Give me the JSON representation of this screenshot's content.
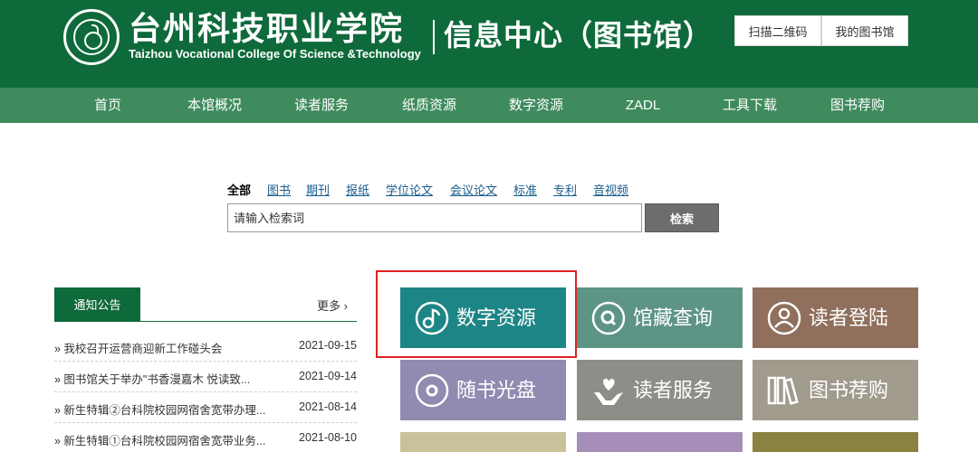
{
  "header": {
    "college_name_cn": "台州科技职业学院",
    "college_name_en": "Taizhou Vocational College Of Science &Technology",
    "center_title": "信息中心（图书馆）",
    "buttons": [
      {
        "label": "扫描二维码"
      },
      {
        "label": "我的图书馆"
      }
    ]
  },
  "nav": {
    "items": [
      {
        "label": "首页"
      },
      {
        "label": "本馆概况"
      },
      {
        "label": "读者服务"
      },
      {
        "label": "纸质资源"
      },
      {
        "label": "数字资源"
      },
      {
        "label": "ZADL"
      },
      {
        "label": "工具下载"
      },
      {
        "label": "图书荐购"
      }
    ]
  },
  "search": {
    "tabs": [
      {
        "label": "全部",
        "active": true
      },
      {
        "label": "图书"
      },
      {
        "label": "期刊"
      },
      {
        "label": "报纸"
      },
      {
        "label": "学位论文"
      },
      {
        "label": "会议论文"
      },
      {
        "label": "标准"
      },
      {
        "label": "专利"
      },
      {
        "label": "音视频"
      }
    ],
    "placeholder": "请输入检索词",
    "button_label": "检索"
  },
  "notices": {
    "tab_label": "通知公告",
    "more_label": "更多",
    "items": [
      {
        "title": "» 我校召开运营商迎新工作碰头会",
        "date": "2021-09-15"
      },
      {
        "title": "» 图书馆关于举办\"书香漫嘉木 悦读致...",
        "date": "2021-09-14"
      },
      {
        "title": "» 新生特辑②台科院校园网宿舍宽带办理...",
        "date": "2021-08-14"
      },
      {
        "title": "» 新生特辑①台科院校园网宿舍宽带业务...",
        "date": "2021-08-10"
      }
    ]
  },
  "tiles": [
    {
      "label": "数字资源",
      "color": "#1d8585",
      "icon": "disc-music-icon"
    },
    {
      "label": "馆藏查询",
      "color": "#5d9486",
      "icon": "search-circle-icon"
    },
    {
      "label": "读者登陆",
      "color": "#906f5c",
      "icon": "user-icon"
    },
    {
      "label": "随书光盘",
      "color": "#8f8bb1",
      "icon": "cd-icon"
    },
    {
      "label": "读者服务",
      "color": "#8e8d87",
      "icon": "hand-heart-icon"
    },
    {
      "label": "图书荐购",
      "color": "#a19b8e",
      "icon": "books-icon"
    }
  ],
  "colors": {
    "brand_green": "#0f6a3b",
    "nav_green": "#3f8b5d",
    "highlight_red": "#e02222"
  }
}
